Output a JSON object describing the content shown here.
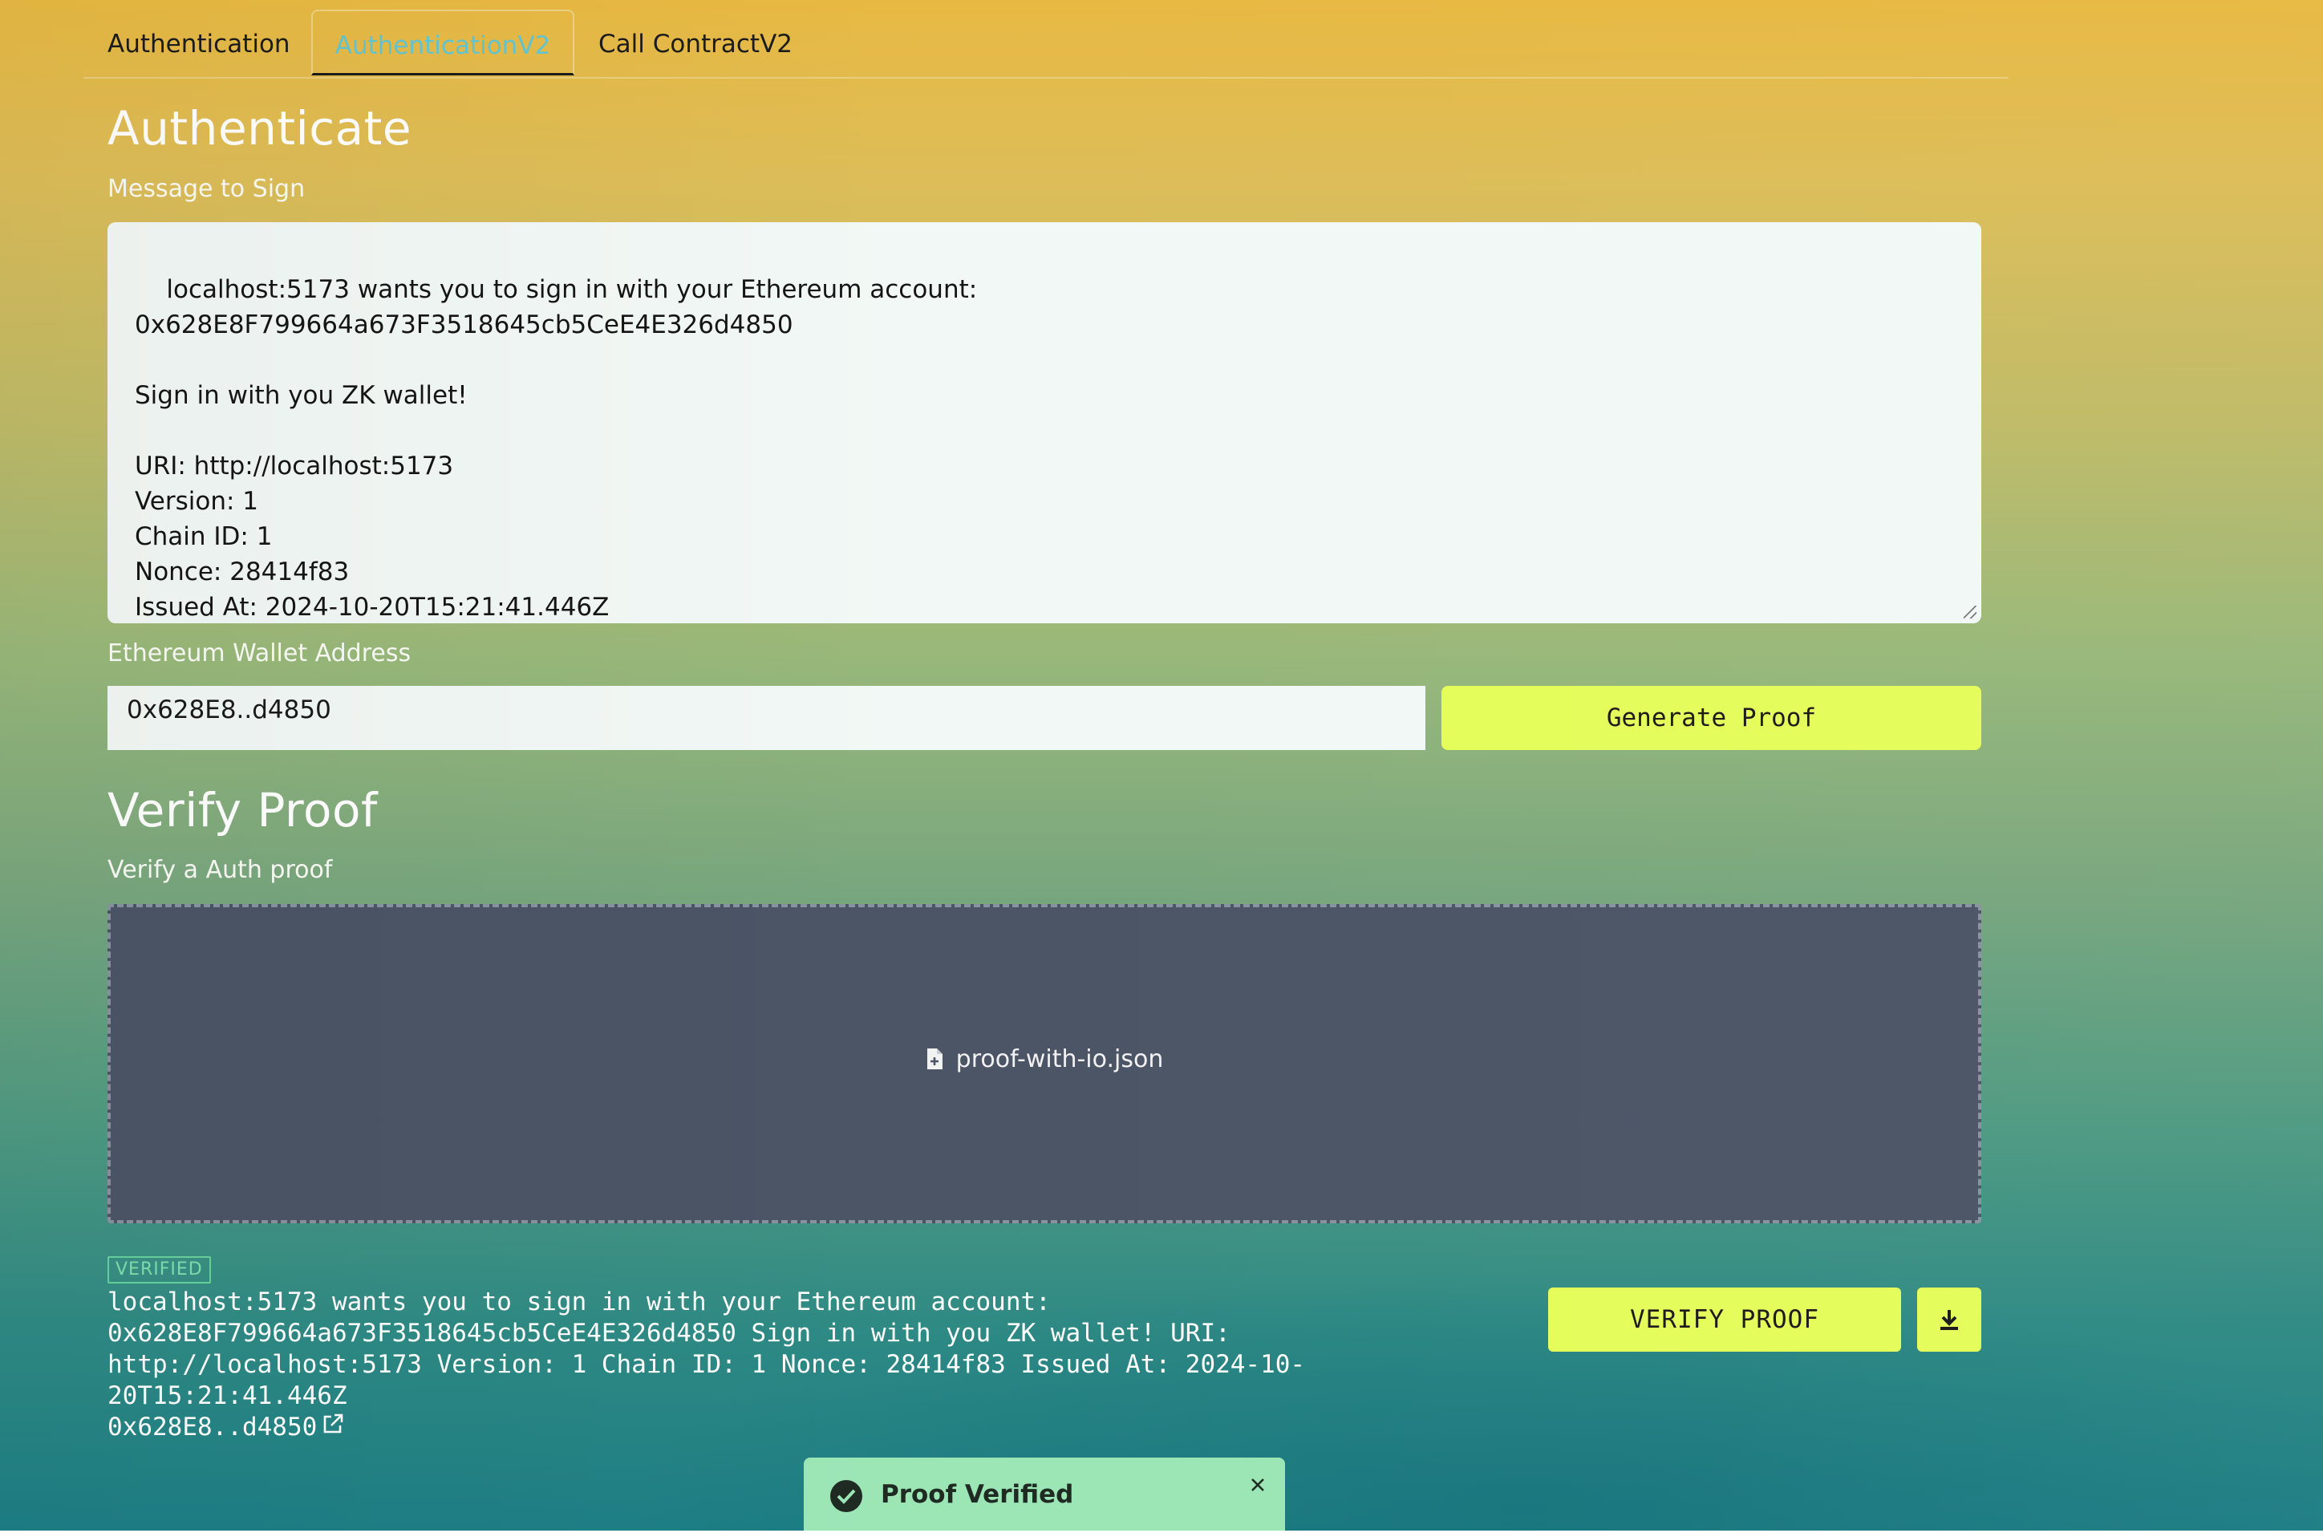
{
  "tabs": [
    "Authentication",
    "AuthenticationV2",
    "Call ContractV2"
  ],
  "authenticate": {
    "title": "Authenticate",
    "message_label": "Message to Sign",
    "message": "localhost:5173 wants you to sign in with your Ethereum account:\n0x628E8F799664a673F3518645cb5CeE4E326d4850\n\nSign in with you ZK wallet!\n\nURI: http://localhost:5173\nVersion: 1\nChain ID: 1\nNonce: 28414f83\nIssued At: 2024-10-20T15:21:41.446Z",
    "wallet_label": "Ethereum Wallet Address",
    "wallet_value": "0x628E8..d4850",
    "generate_button": "Generate Proof"
  },
  "verify": {
    "title": "Verify Proof",
    "subtitle": "Verify a Auth proof",
    "file_name": "proof-with-io.json",
    "badge": "VERIFIED",
    "verified_message": "localhost:5173 wants you to sign in with your Ethereum account: 0x628E8F799664a673F3518645cb5CeE4E326d4850 Sign in with you ZK wallet! URI: http://localhost:5173 Version: 1 Chain ID: 1 Nonce: 28414f83 Issued At: 2024-10-20T15:21:41.446Z",
    "verified_address": "0x628E8..d4850",
    "verify_button": "VERIFY PROOF"
  },
  "toast": {
    "text": "Proof Verified"
  },
  "colors": {
    "accent_button": "#e5fd5a",
    "active_tab": "#62c6d3",
    "dropzone": "#4b5566",
    "toast": "#9ce6b6",
    "verified_badge": "#66d39a"
  },
  "icons": [
    "file-icon",
    "external-link-icon",
    "download-icon",
    "check-circle-icon",
    "close-icon"
  ]
}
